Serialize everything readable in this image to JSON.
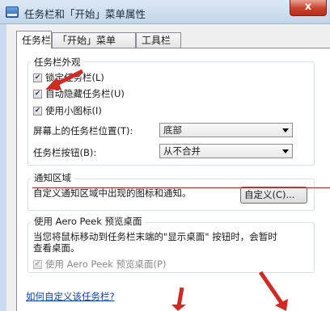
{
  "window": {
    "title": "任务栏和「开始」菜单属性",
    "close_label": "x"
  },
  "tabs": [
    {
      "label": "任务栏",
      "active": true
    },
    {
      "label": "「开始」菜单",
      "active": false
    },
    {
      "label": "工具栏",
      "active": false
    }
  ],
  "appearance": {
    "group_title": "任务栏外观",
    "lock_taskbar": {
      "label": "锁定任务栏(L)",
      "checked": true
    },
    "auto_hide": {
      "label": "自动隐藏任务栏(U)",
      "checked": true
    },
    "small_icons": {
      "label": "使用小图标(I)",
      "checked": true
    },
    "location_label": "屏幕上的任务栏位置(T):",
    "location_value": "底部",
    "buttons_label": "任务栏按钮(B):",
    "buttons_value": "从不合并"
  },
  "notification": {
    "group_title": "通知区域",
    "description": "自定义通知区域中出现的图标和通知。",
    "customize_button": "自定义(C)..."
  },
  "aero_peek": {
    "group_title": "使用 Aero Peek 预览桌面",
    "description_line1": "当您将鼠标移动到任务栏末端的\"显示桌面\" 按钮时，会暂时",
    "description_line2": "查看桌面。",
    "checkbox_label": "使用 Aero Peek 预览桌面(P)",
    "checkbox_checked": true,
    "checkbox_disabled": true
  },
  "help_link": "如何自定义该任务栏?",
  "colors": {
    "annotation_red": "#d12a22",
    "window_bg": "#f0f0f0",
    "link": "#0b3fa8"
  }
}
